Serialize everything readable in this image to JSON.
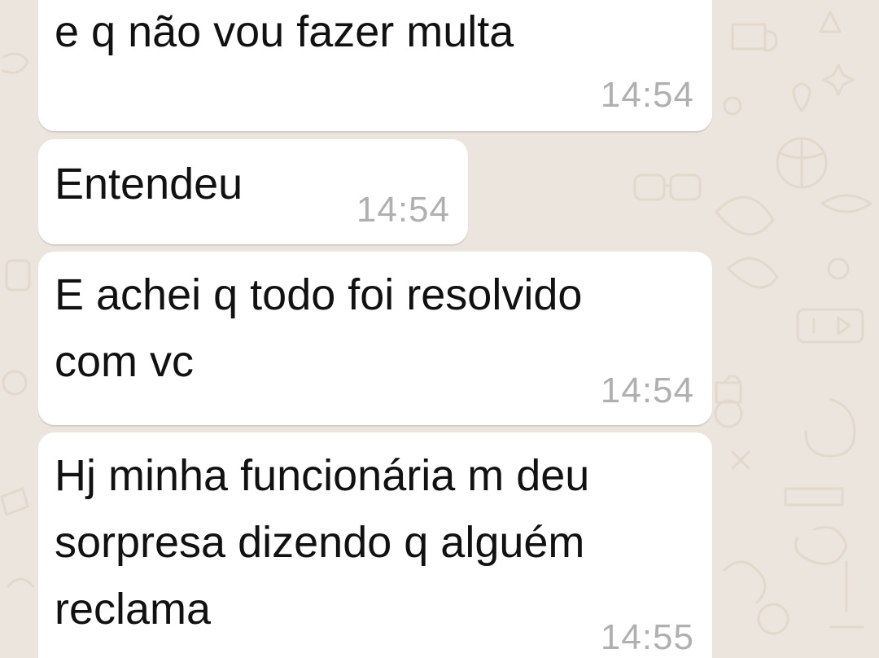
{
  "messages": [
    {
      "text": "e q não vou fazer multa",
      "time": "14:54"
    },
    {
      "text": "Entendeu",
      "time": "14:54"
    },
    {
      "text": "E achei q todo foi resolvido\ncom vc",
      "time": "14:54"
    },
    {
      "text": "Hj minha funcionária m deu\nsorpresa dizendo q alguém\nreclama",
      "time": "14:55"
    }
  ],
  "colors": {
    "background": "#ece5dd",
    "bubble": "#ffffff",
    "text": "#111111",
    "timestamp": "#b0b0b0",
    "doodle": "#e2d9cc"
  }
}
